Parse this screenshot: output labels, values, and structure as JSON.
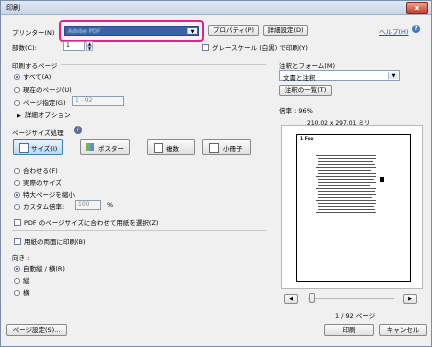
{
  "window": {
    "title": "印刷",
    "close_label": "x"
  },
  "printer": {
    "label": "プリンター(N)",
    "value": "Adobe PDF",
    "properties_button": "プロパティ(P)",
    "advanced_button": "詳細設定(D)",
    "help_link": "ヘルプ(H)"
  },
  "copies": {
    "label": "部数(C):",
    "value": "1",
    "grayscale_label": "グレースケール (白黒) で印刷(Y)"
  },
  "pages": {
    "heading": "印刷するページ",
    "options": [
      "すべて(A)",
      "現在のページ(U)",
      "ページ指定(G)"
    ],
    "range_value": "1 - 92",
    "more_options": "詳細オプション"
  },
  "sizing": {
    "heading": "ページサイズ処理",
    "tabs": [
      "サイズ(I)",
      "ポスター",
      "複数",
      "小冊子"
    ],
    "options": [
      "合わせる(F)",
      "実際のサイズ",
      "特大ページを縮小",
      "カスタム倍率:"
    ],
    "custom_value": "100",
    "custom_unit": "%",
    "pdf_size_checkbox": "PDF のページサイズに合わせて用紙を選択(Z)"
  },
  "duplex": {
    "label": "用紙の両面に印刷(B)"
  },
  "orientation": {
    "heading": "向き :",
    "options": [
      "自動縦 / 横(R)",
      "縦",
      "横"
    ]
  },
  "comments": {
    "heading": "注釈とフォーム(M)",
    "value": "文書と注釈",
    "summary_button": "注釈の一覧(T)"
  },
  "preview": {
    "scale_label": "倍率 : 96%",
    "page_size": "210.02 x 297.01 ミリ",
    "page_title": "1  Fox",
    "page_counter": "1 / 92 ページ",
    "zoom_position": 0
  },
  "footer": {
    "page_setup": "ページ設定(S)...",
    "print": "印刷",
    "cancel": "キャンセル"
  }
}
